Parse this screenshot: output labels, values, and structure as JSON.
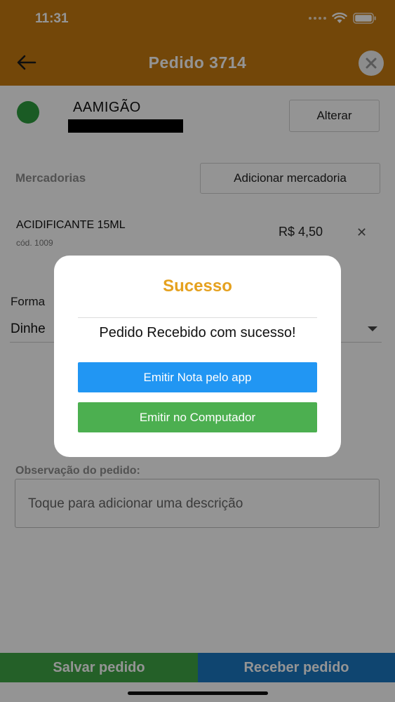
{
  "status_bar": {
    "time": "11:31"
  },
  "header": {
    "title": "Pedido 3714"
  },
  "client": {
    "name": "AAMIGÃO",
    "change_label": "Alterar",
    "status_color": "#2e9e3e"
  },
  "goods": {
    "section_label": "Mercadorias",
    "add_label": "Adicionar mercadoria",
    "items": [
      {
        "name": "ACIDIFICANTE 15ML",
        "code": "cód. 1009",
        "price": "R$ 4,50",
        "remove_icon": "close-icon"
      }
    ]
  },
  "payment": {
    "label": "Forma",
    "value": "Dinhe"
  },
  "observation": {
    "label": "Observação do pedido:",
    "placeholder": "Toque para adicionar uma descrição"
  },
  "footer": {
    "save_label": "Salvar pedido",
    "receive_label": "Receber pedido"
  },
  "modal": {
    "title": "Sucesso",
    "message": "Pedido Recebido com sucesso!",
    "primary_label": "Emitir Nota pelo app",
    "secondary_label": "Emitir no Computador"
  },
  "colors": {
    "header": "#c77a10",
    "modal_title": "#e5a11f",
    "btn_app": "#2196f3",
    "btn_computer": "#4caf50",
    "btn_save": "#3fa646",
    "btn_receive": "#1a78c2"
  }
}
